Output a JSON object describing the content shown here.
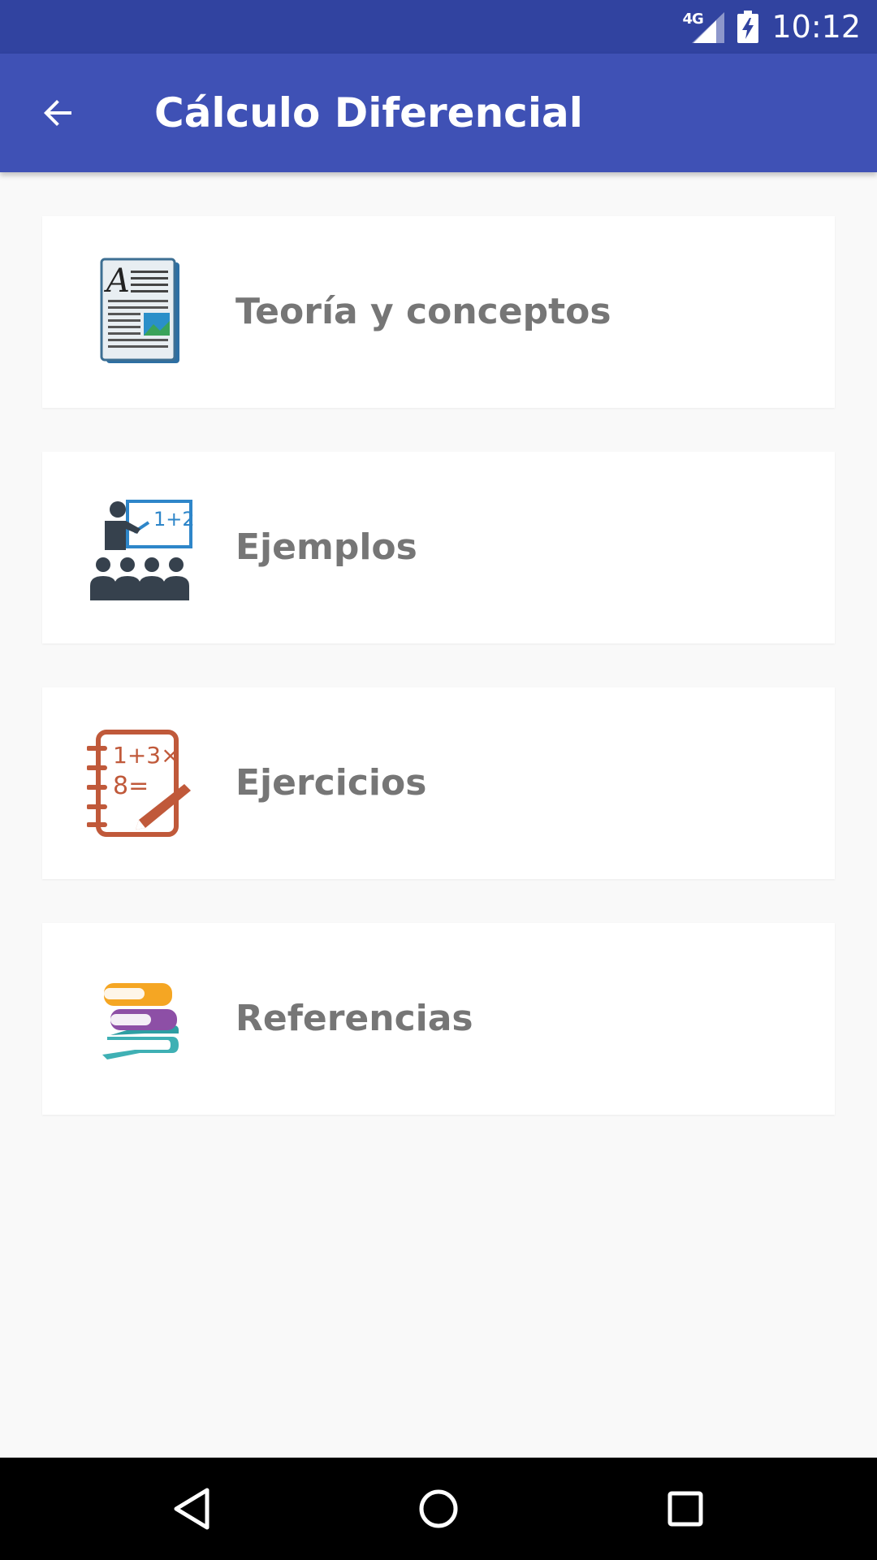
{
  "status_bar": {
    "network": "4G",
    "time": "10:12",
    "icons": [
      "signal-icon",
      "battery-charging-icon"
    ]
  },
  "app_bar": {
    "title": "Cálculo Diferencial",
    "back_icon": "arrow-back-icon"
  },
  "menu": {
    "items": [
      {
        "label": "Teoría y conceptos",
        "icon": "document-icon"
      },
      {
        "label": "Ejemplos",
        "icon": "teacher-class-icon"
      },
      {
        "label": "Ejercicios",
        "icon": "math-notebook-icon"
      },
      {
        "label": "Referencias",
        "icon": "books-icon"
      }
    ]
  },
  "nav_bar": {
    "icons": [
      "back-triangle-icon",
      "home-circle-icon",
      "recents-square-icon"
    ]
  },
  "colors": {
    "status_bar": "#3143a0",
    "app_bar": "#3f51b5",
    "background": "#f9f9f9",
    "card": "#ffffff",
    "label_text": "#767676"
  }
}
